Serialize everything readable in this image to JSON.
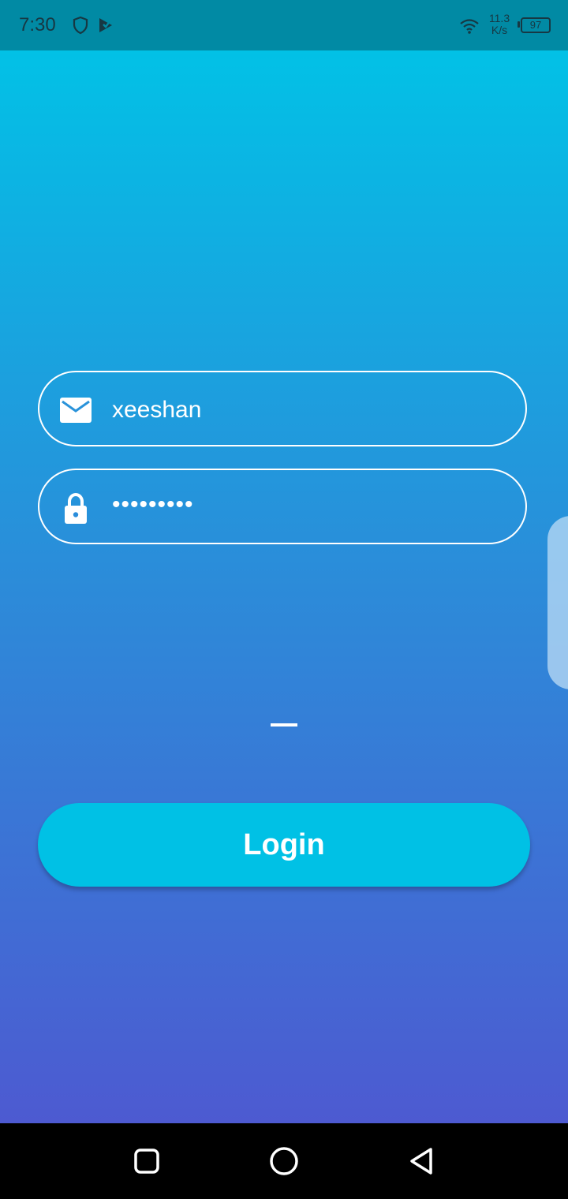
{
  "status_bar": {
    "time": "7:30",
    "net_speed_value": "11.3",
    "net_speed_unit": "K/s",
    "battery_level": "97",
    "icons": [
      "shield-icon",
      "play-store-icon",
      "wifi-icon",
      "battery-icon"
    ]
  },
  "login_form": {
    "username": {
      "icon": "email-icon",
      "value": "xeeshan"
    },
    "password": {
      "icon": "lock-icon",
      "value": "•••••••••"
    },
    "login_label": "Login"
  },
  "nav_bar": {
    "buttons": [
      "recents-button",
      "home-button",
      "back-button"
    ]
  },
  "colors": {
    "status_bar": "#018aa4",
    "gradient_top": "#02c1e6",
    "gradient_bottom": "#4d5ad1",
    "login_button": "#00c1e5",
    "field_border": "#ffffff"
  }
}
